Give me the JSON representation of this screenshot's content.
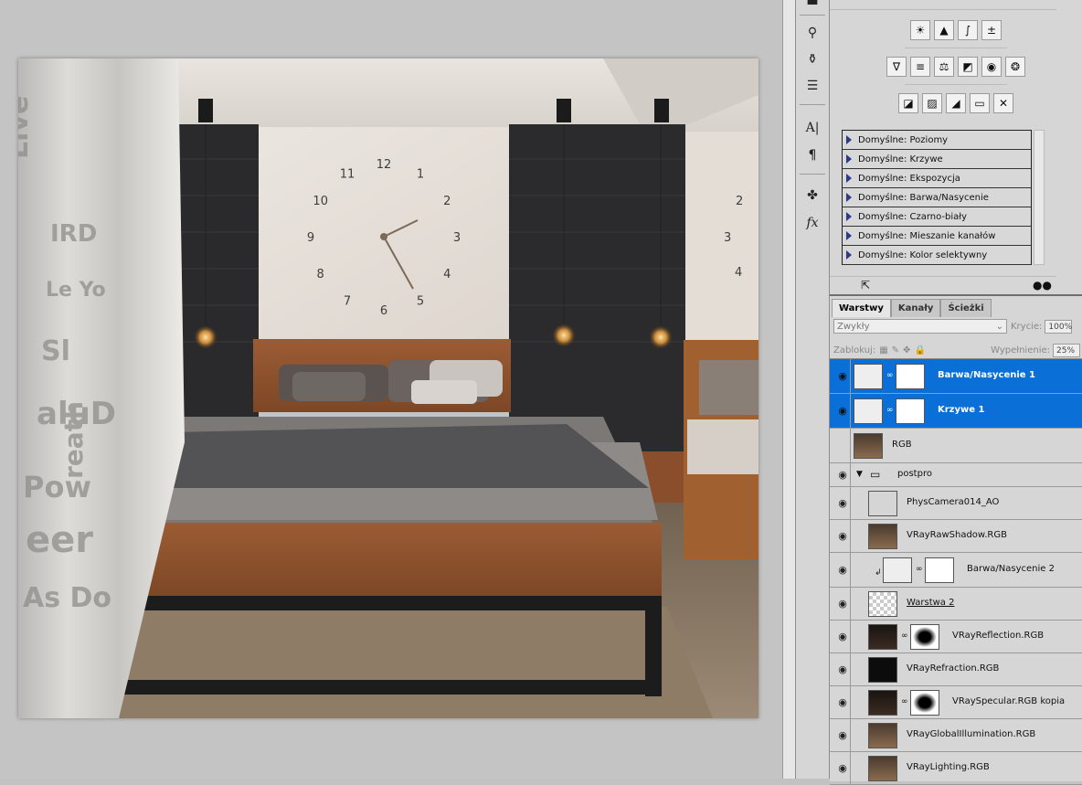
{
  "presets": {
    "items": [
      "Domyślne: Poziomy",
      "Domyślne: Krzywe",
      "Domyślne: Ekspozycja",
      "Domyślne: Barwa/Nasycenie",
      "Domyślne: Czarno-biały",
      "Domyślne: Mieszanie kanałów",
      "Domyślne: Kolor selektywny"
    ]
  },
  "adjustments": {
    "row1": [
      "brightness-contrast-icon",
      "levels-icon",
      "curves-icon",
      "exposure-icon"
    ],
    "row2": [
      "vibrance-icon",
      "hue-saturation-icon",
      "color-balance-icon",
      "black-white-icon",
      "photo-filter-icon",
      "channel-mixer-icon"
    ],
    "row3": [
      "invert-icon",
      "posterize-icon",
      "threshold-icon",
      "gradient-map-icon",
      "selective-color-icon"
    ]
  },
  "layers_panel": {
    "tabs": [
      "Warstwy",
      "Kanały",
      "Ścieżki"
    ],
    "blend_mode": "Zwykły",
    "opacity_label": "Krycie:",
    "opacity_value": "100%",
    "lock_label": "Zablokuj:",
    "fill_label": "Wypełnienie:",
    "fill_value": "25%",
    "layers": [
      {
        "name": "Barwa/Nasycenie 1",
        "selected": true,
        "visible": true,
        "type": "adjustment"
      },
      {
        "name": "Krzywe 1",
        "selected": true,
        "visible": true,
        "type": "adjustment"
      },
      {
        "name": "RGB",
        "selected": false,
        "visible": false,
        "type": "image"
      },
      {
        "name": "postpro",
        "selected": false,
        "visible": true,
        "type": "group"
      },
      {
        "name": "PhysCamera014_AO",
        "selected": false,
        "visible": true,
        "type": "smart"
      },
      {
        "name": "VRayRawShadow.RGB",
        "selected": false,
        "visible": true,
        "type": "image"
      },
      {
        "name": "Barwa/Nasycenie 2",
        "selected": false,
        "visible": true,
        "type": "adjustment-clipped"
      },
      {
        "name": "Warstwa 2",
        "selected": false,
        "visible": true,
        "type": "transparent"
      },
      {
        "name": "VRayReflection.RGB",
        "selected": false,
        "visible": true,
        "type": "masked"
      },
      {
        "name": "VRayRefraction.RGB",
        "selected": false,
        "visible": true,
        "type": "dark"
      },
      {
        "name": "VRaySpecular.RGB kopia",
        "selected": false,
        "visible": true,
        "type": "masked"
      },
      {
        "name": "VRayGlobalIllumination.RGB",
        "selected": false,
        "visible": true,
        "type": "image"
      },
      {
        "name": "VRayLighting.RGB",
        "selected": false,
        "visible": true,
        "type": "image"
      }
    ]
  },
  "canvas": {
    "clock_numbers": [
      "12",
      "1",
      "2",
      "3",
      "4",
      "5",
      "6",
      "7",
      "8",
      "9",
      "10",
      "11"
    ],
    "clock_hour": 5,
    "clock_minute": 10
  },
  "colors": {
    "selection": "#0a6fd6",
    "panel_bg": "#d6d6d6",
    "canvas_bg": "#c4c4c4"
  }
}
